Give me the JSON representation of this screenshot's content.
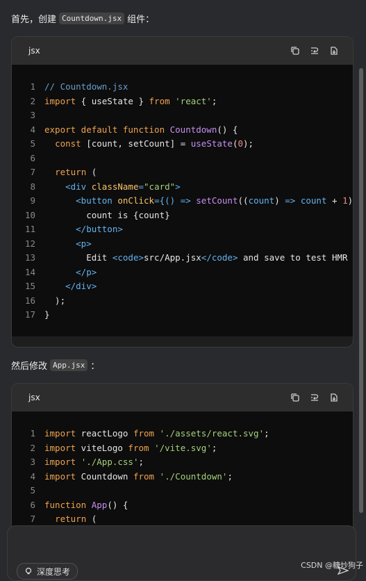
{
  "intro": {
    "before": "首先，创建",
    "file": "Countdown.jsx",
    "after": "组件："
  },
  "block1": {
    "lang": "jsx",
    "lines": [
      [
        [
          "c",
          "// Countdown.jsx"
        ]
      ],
      [
        [
          "k",
          "import"
        ],
        [
          "tx",
          " { useState } "
        ],
        [
          "k",
          "from"
        ],
        [
          "tx",
          " "
        ],
        [
          "s",
          "'react'"
        ],
        [
          "tx",
          ";"
        ]
      ],
      [],
      [
        [
          "k",
          "export default function"
        ],
        [
          "tx",
          " "
        ],
        [
          "f",
          "Countdown"
        ],
        [
          "tx",
          "() {"
        ]
      ],
      [
        [
          "tx",
          "  "
        ],
        [
          "k",
          "const"
        ],
        [
          "tx",
          " [count, setCount] = "
        ],
        [
          "f",
          "useState"
        ],
        [
          "tx",
          "("
        ],
        [
          "n",
          "0"
        ],
        [
          "tx",
          ");"
        ]
      ],
      [],
      [
        [
          "tx",
          "  "
        ],
        [
          "k",
          "return"
        ],
        [
          "tx",
          " ("
        ]
      ],
      [
        [
          "tx",
          "    "
        ],
        [
          "t",
          "<div"
        ],
        [
          "tx",
          " "
        ],
        [
          "a",
          "className"
        ],
        [
          "t",
          "="
        ],
        [
          "s",
          "\"card\""
        ],
        [
          "t",
          ">"
        ]
      ],
      [
        [
          "tx",
          "      "
        ],
        [
          "t",
          "<button"
        ],
        [
          "tx",
          " "
        ],
        [
          "a",
          "onClick"
        ],
        [
          "t",
          "={"
        ],
        [
          "t",
          "() => "
        ],
        [
          "f",
          "setCount"
        ],
        [
          "tx",
          "(("
        ],
        [
          "t",
          "count"
        ],
        [
          "tx",
          ") "
        ],
        [
          "t",
          "=>"
        ],
        [
          "tx",
          " "
        ],
        [
          "t",
          "count"
        ],
        [
          "tx",
          " + "
        ],
        [
          "n",
          "1"
        ],
        [
          "tx",
          ")"
        ]
      ],
      [
        [
          "tx",
          "        count is {count}"
        ]
      ],
      [
        [
          "tx",
          "      "
        ],
        [
          "t",
          "</button>"
        ]
      ],
      [
        [
          "tx",
          "      "
        ],
        [
          "t",
          "<p>"
        ]
      ],
      [
        [
          "tx",
          "        Edit "
        ],
        [
          "t",
          "<code>"
        ],
        [
          "tx",
          "src/App.jsx"
        ],
        [
          "t",
          "</code>"
        ],
        [
          "tx",
          " and save to test HMR"
        ]
      ],
      [
        [
          "tx",
          "      "
        ],
        [
          "t",
          "</p>"
        ]
      ],
      [
        [
          "tx",
          "    "
        ],
        [
          "t",
          "</div>"
        ]
      ],
      [
        [
          "tx",
          "  );"
        ]
      ],
      [
        [
          "tx",
          "}"
        ]
      ]
    ]
  },
  "mid": {
    "before": "然后修改",
    "file": "App.jsx",
    "after": "："
  },
  "block2": {
    "lang": "jsx",
    "lines": [
      [
        [
          "k",
          "import"
        ],
        [
          "tx",
          " reactLogo "
        ],
        [
          "k",
          "from"
        ],
        [
          "tx",
          " "
        ],
        [
          "s",
          "'./assets/react.svg'"
        ],
        [
          "tx",
          ";"
        ]
      ],
      [
        [
          "k",
          "import"
        ],
        [
          "tx",
          " viteLogo "
        ],
        [
          "k",
          "from"
        ],
        [
          "tx",
          " "
        ],
        [
          "s",
          "'/vite.svg'"
        ],
        [
          "tx",
          ";"
        ]
      ],
      [
        [
          "k",
          "import"
        ],
        [
          "tx",
          " "
        ],
        [
          "s",
          "'./App.css'"
        ],
        [
          "tx",
          ";"
        ]
      ],
      [
        [
          "k",
          "import"
        ],
        [
          "tx",
          " Countdown "
        ],
        [
          "k",
          "from"
        ],
        [
          "tx",
          " "
        ],
        [
          "s",
          "'./Countdown'"
        ],
        [
          "tx",
          ";"
        ]
      ],
      [],
      [
        [
          "k",
          "function"
        ],
        [
          "tx",
          " "
        ],
        [
          "f",
          "App"
        ],
        [
          "tx",
          "() {"
        ]
      ],
      [
        [
          "tx",
          "  "
        ],
        [
          "k",
          "return"
        ],
        [
          "tx",
          " ("
        ]
      ]
    ]
  },
  "composer": {
    "deep_think_label": "深度思考"
  },
  "watermark": "CSDN @糖炒狗子"
}
